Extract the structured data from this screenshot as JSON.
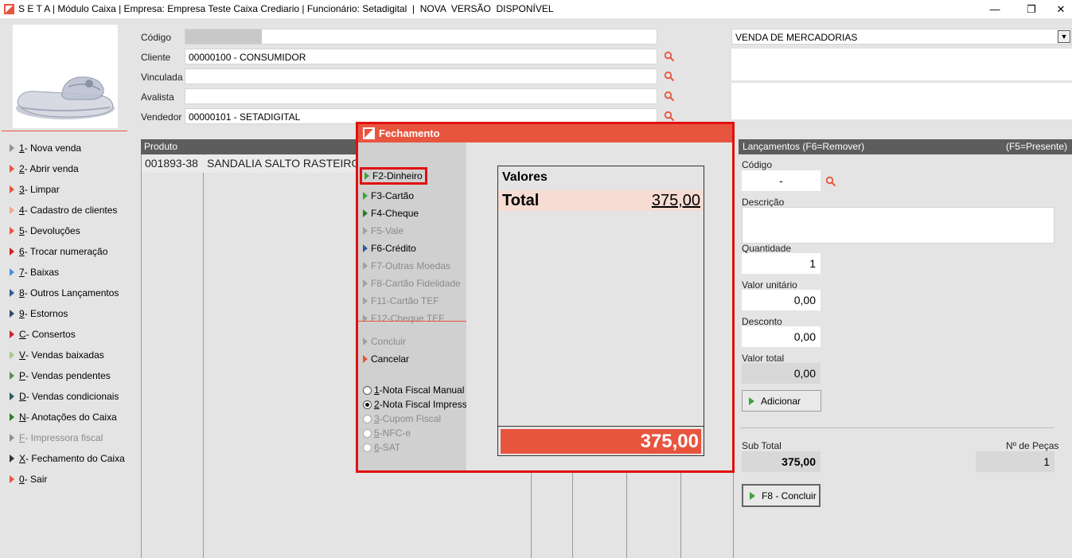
{
  "window": {
    "title": "S E T A | Módulo Caixa | Empresa: Empresa Teste Caixa Crediario | Funcionário: Setadigital  |  NOVA  VERSÃO  DISPONÍVEL",
    "minimize": "—",
    "restore": "❐",
    "close": "✕"
  },
  "colors": {
    "accent": "#e8553f",
    "highlight": "#e01010",
    "header_dark": "#5d5d5d",
    "green": "#3ca53c"
  },
  "menu": [
    {
      "key": "1",
      "label": " - Nova venda",
      "color": "#909090"
    },
    {
      "key": "2",
      "label": " - Abrir venda",
      "color": "#e8553f"
    },
    {
      "key": "3",
      "label": " - Limpar",
      "color": "#e8553f"
    },
    {
      "key": "4",
      "label": " - Cadastro de clientes",
      "color": "#f0a880"
    },
    {
      "key": "5",
      "label": " - Devoluções",
      "color": "#e8553f"
    },
    {
      "key": "6",
      "label": " - Trocar numeração",
      "color": "#d02020"
    },
    {
      "key": "7",
      "label": " - Baixas",
      "color": "#4a90d9"
    },
    {
      "key": "8",
      "label": " - Outros Lançamentos",
      "color": "#2e5d9a"
    },
    {
      "key": "9",
      "label": " - Estornos",
      "color": "#2e4a6a"
    },
    {
      "key": "C",
      "label": " - Consertos",
      "color": "#d02030"
    },
    {
      "key": "V",
      "label": " - Vendas baixadas",
      "color": "#a0c890"
    },
    {
      "key": "P",
      "label": " - Vendas pendentes",
      "color": "#5a8a5a"
    },
    {
      "key": "D",
      "label": " - Vendas condicionais",
      "color": "#2e5d5d"
    },
    {
      "key": "N",
      "label": " - Anotações do Caixa",
      "color": "#2e7a2e"
    },
    {
      "key": "F",
      "label": " - Impressora fiscal",
      "color": "#909090",
      "disabled": true
    },
    {
      "key": "X",
      "label": " - Fechamento do Caixa",
      "color": "#333333"
    },
    {
      "key": "0",
      "label": " - Sair",
      "color": "#e8553f"
    }
  ],
  "form": {
    "codigo_label": "Código",
    "cliente_label": "Cliente",
    "cliente_value": "00000100 - CONSUMIDOR",
    "vinculada_label": "Vinculada",
    "avalista_label": "Avalista",
    "vendedor_label": "Vendedor",
    "vendedor_value": "00000101 - SETADIGITAL",
    "operation_select": "VENDA DE MERCADORIAS"
  },
  "grid": {
    "header": "Produto",
    "rows": [
      {
        "code": "001893-38",
        "desc": "SANDALIA SALTO RASTEIRO"
      }
    ]
  },
  "right": {
    "header_left": "Lançamentos (F6=Remover)",
    "header_right": "(F5=Presente)",
    "codigo_label": "Código",
    "codigo_value": "-",
    "descricao_label": "Descrição",
    "quantidade_label": "Quantidade",
    "quantidade_value": "1",
    "valor_unitario_label": "Valor unitário",
    "valor_unitario_value": "0,00",
    "desconto_label": "Desconto",
    "desconto_value": "0,00",
    "valor_total_label": "Valor total",
    "valor_total_value": "0,00",
    "adicionar_label": "Adicionar",
    "subtotal_label": "Sub Total",
    "subtotal_value": "375,00",
    "pecas_label": "Nº de Peças",
    "pecas_value": "1",
    "concluir_label": "F8 - Concluir"
  },
  "modal": {
    "title": "Fechamento",
    "payments": [
      {
        "label": "F2-Dinheiro",
        "enabled": true,
        "color": "#3ca53c"
      },
      {
        "label": "F3-Cartão",
        "enabled": true,
        "color": "#3ca53c"
      },
      {
        "label": "F4-Cheque",
        "enabled": true,
        "color": "#2e7a2e"
      },
      {
        "label": "F5-Vale",
        "enabled": false,
        "color": "#a0a0a0"
      },
      {
        "label": "F6-Crédito",
        "enabled": true,
        "color": "#2e5d9a"
      },
      {
        "label": "F7-Outras Moedas",
        "enabled": false,
        "color": "#a0a0a0"
      },
      {
        "label": "F8-Cartão Fidelidade",
        "enabled": false,
        "color": "#a0a0a0"
      },
      {
        "label": "F11-Cartão TEF",
        "enabled": false,
        "color": "#a0a0a0"
      },
      {
        "label": "F12-Cheque TEF",
        "enabled": false,
        "color": "#a0a0a0"
      }
    ],
    "concluir": "Concluir",
    "cancelar": "Cancelar",
    "radios": [
      {
        "key": "1",
        "label": "-Nota Fiscal Manual",
        "checked": false,
        "enabled": true
      },
      {
        "key": "2",
        "label": "-Nota Fiscal Impressa",
        "checked": true,
        "enabled": true
      },
      {
        "key": "3",
        "label": "-Cupom Fiscal",
        "checked": false,
        "enabled": false
      },
      {
        "key": "5",
        "label": "-NFC-e",
        "checked": false,
        "enabled": false
      },
      {
        "key": "6",
        "label": "-SAT",
        "checked": false,
        "enabled": false
      }
    ],
    "valores_title": "Valores",
    "total_label": "Total",
    "total_value": "375,00",
    "footer_value": "375,00"
  }
}
